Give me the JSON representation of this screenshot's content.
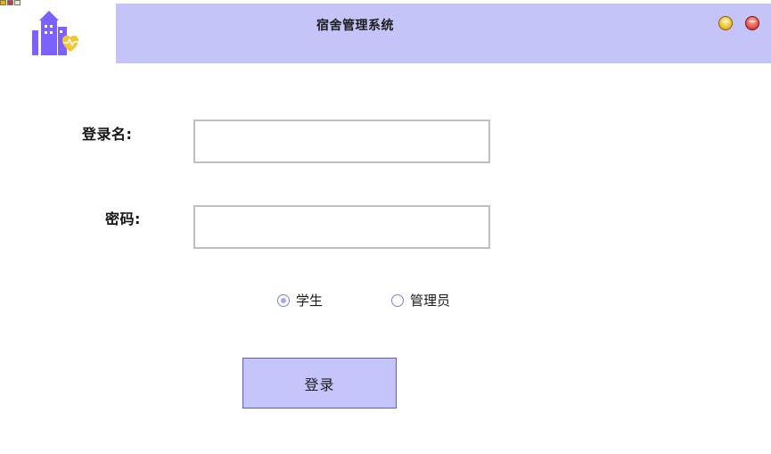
{
  "window": {
    "title": "宿舍管理系统"
  },
  "form": {
    "username_label": "登录名:",
    "password_label": "密码:",
    "username_value": "",
    "password_value": "",
    "role_options": [
      {
        "label": "学生",
        "selected": true
      },
      {
        "label": "管理员",
        "selected": false
      }
    ],
    "submit_label": "登录"
  },
  "icons": {
    "logo": "dormitory-building-heart-icon",
    "minimize": "minimize-orb-icon",
    "close": "close-orb-icon"
  },
  "colors": {
    "title_bar": "#c4c4f8",
    "logo_primary": "#7b61ff",
    "logo_accent": "#f6c532",
    "button_bg": "#c5c5fb",
    "button_border": "#5b5bd8"
  }
}
